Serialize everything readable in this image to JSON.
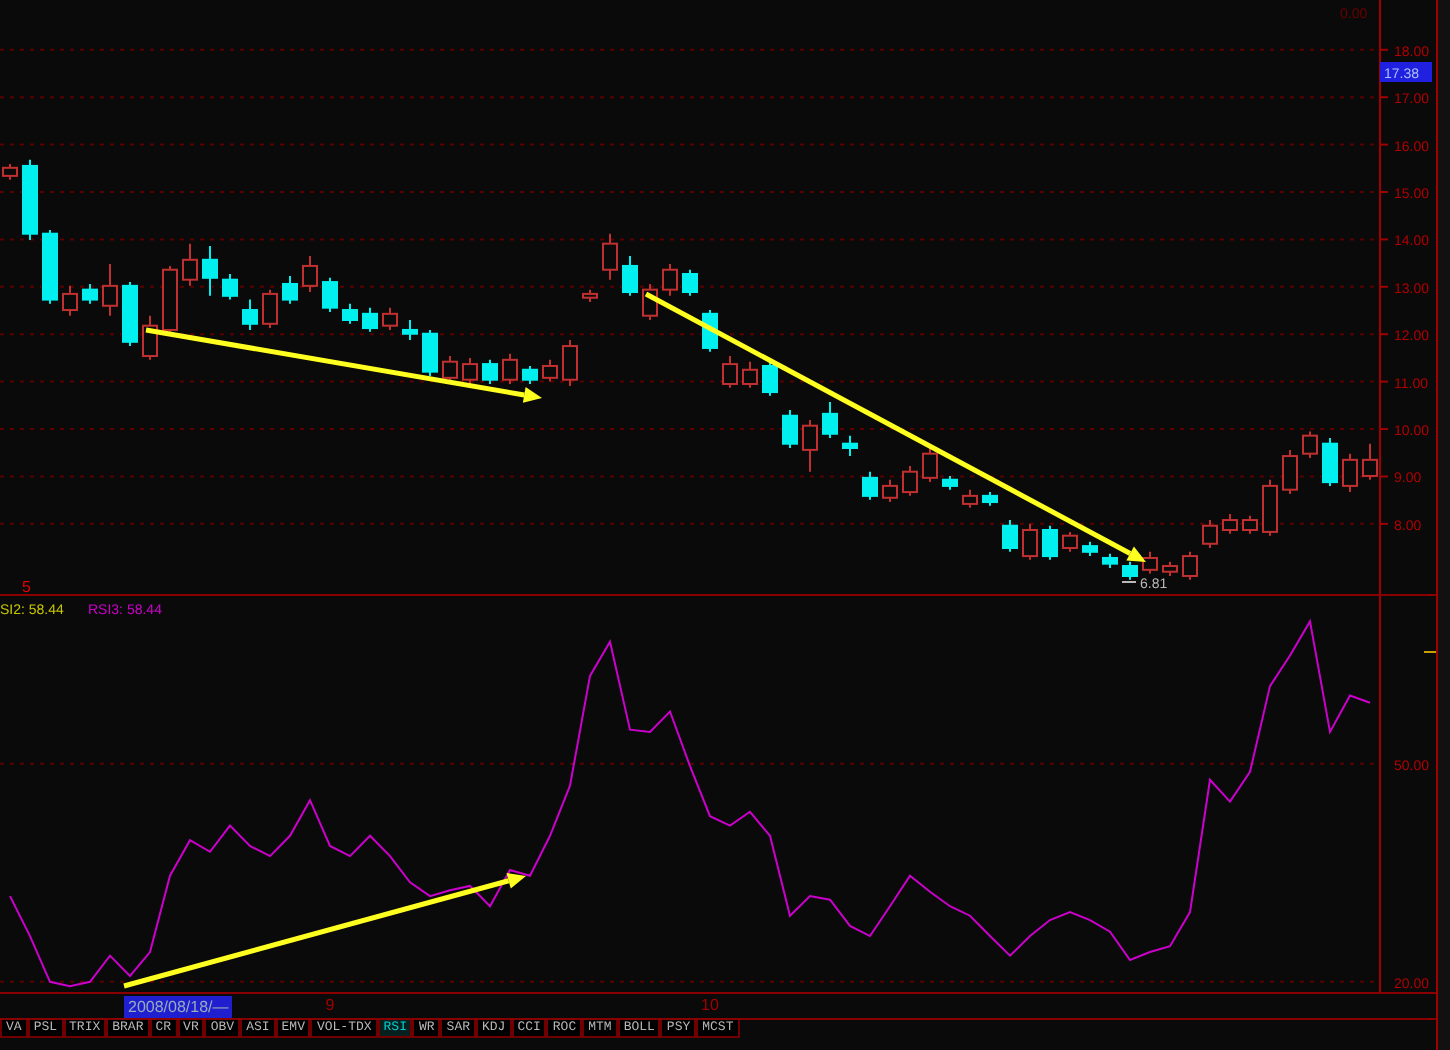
{
  "price_chart": {
    "top_label": "0.00",
    "last_price": "17.38",
    "low_marker": "6.81",
    "panel_marker": "5",
    "chart_data": {
      "type": "candlestick",
      "grid": true,
      "ylim": [
        6.52,
        19.05
      ],
      "categories": [
        null,
        null,
        null,
        null,
        null,
        null,
        null,
        null,
        null,
        null,
        null,
        null,
        null,
        null,
        null,
        null,
        null,
        null,
        null,
        null,
        null,
        null,
        null,
        null,
        null,
        null,
        null,
        null,
        null,
        null,
        null,
        null,
        null,
        null,
        null,
        null,
        null,
        null,
        null,
        null,
        null,
        null,
        null,
        null,
        null,
        null,
        null,
        null,
        null,
        null,
        null,
        null,
        null,
        null,
        null,
        null,
        null,
        null,
        null,
        null,
        null,
        null,
        null,
        null,
        null,
        null,
        null,
        null,
        null
      ],
      "yticks": [
        {
          "value": 18,
          "label": "18.00"
        },
        {
          "value": 17,
          "label": "17.00"
        },
        {
          "value": 16,
          "label": "16.00"
        },
        {
          "value": 15,
          "label": "15.00"
        },
        {
          "value": 14,
          "label": "14.00"
        },
        {
          "value": 13,
          "label": "13.00"
        },
        {
          "value": 12,
          "label": "12.00"
        },
        {
          "value": 11,
          "label": "11.00"
        },
        {
          "value": 10,
          "label": "10.00"
        },
        {
          "value": 9,
          "label": "9.00"
        },
        {
          "value": 8,
          "label": "8.00"
        }
      ],
      "ohlc": [
        [
          15.34,
          15.59,
          15.26,
          15.51
        ],
        [
          15.55,
          15.68,
          13.99,
          14.12
        ],
        [
          14.12,
          14.2,
          12.64,
          12.73
        ],
        [
          12.51,
          13.02,
          12.39,
          12.85
        ],
        [
          12.94,
          13.06,
          12.64,
          12.73
        ],
        [
          12.6,
          13.48,
          12.39,
          13.02
        ],
        [
          13.02,
          13.1,
          11.75,
          11.84
        ],
        [
          11.54,
          12.39,
          11.46,
          12.18
        ],
        [
          12.09,
          13.44,
          12.01,
          13.36
        ],
        [
          13.15,
          13.91,
          13.02,
          13.57
        ],
        [
          13.57,
          13.86,
          12.81,
          13.19
        ],
        [
          13.15,
          13.27,
          12.73,
          12.81
        ],
        [
          12.51,
          12.73,
          12.09,
          12.22
        ],
        [
          12.22,
          12.94,
          12.13,
          12.85
        ],
        [
          13.06,
          13.23,
          12.64,
          12.73
        ],
        [
          13.02,
          13.65,
          12.89,
          13.44
        ],
        [
          13.1,
          13.19,
          12.47,
          12.56
        ],
        [
          12.51,
          12.64,
          12.22,
          12.3
        ],
        [
          12.43,
          12.56,
          12.05,
          12.13
        ],
        [
          12.18,
          12.56,
          12.09,
          12.43
        ],
        [
          12.09,
          12.3,
          11.88,
          12.01
        ],
        [
          12.01,
          12.09,
          11.12,
          11.21
        ],
        [
          11.08,
          11.54,
          11.0,
          11.42
        ],
        [
          11.04,
          11.5,
          10.95,
          11.37
        ],
        [
          11.37,
          11.46,
          10.95,
          11.04
        ],
        [
          11.04,
          11.59,
          10.95,
          11.46
        ],
        [
          11.25,
          11.33,
          10.95,
          11.04
        ],
        [
          11.08,
          11.46,
          11.0,
          11.33
        ],
        [
          11.04,
          11.88,
          10.91,
          11.75
        ],
        [
          12.77,
          12.94,
          12.68,
          12.85
        ],
        [
          13.36,
          14.12,
          13.15,
          13.91
        ],
        [
          13.44,
          13.65,
          12.81,
          12.89
        ],
        [
          12.39,
          13.06,
          12.3,
          12.94
        ],
        [
          12.94,
          13.48,
          12.81,
          13.36
        ],
        [
          13.27,
          13.36,
          12.81,
          12.89
        ],
        [
          12.43,
          12.51,
          11.63,
          11.71
        ],
        [
          10.95,
          11.54,
          10.87,
          11.37
        ],
        [
          10.95,
          11.42,
          10.87,
          11.25
        ],
        [
          11.33,
          11.46,
          10.7,
          10.78
        ],
        [
          10.28,
          10.4,
          9.6,
          9.69
        ],
        [
          9.56,
          10.19,
          9.1,
          10.07
        ],
        [
          10.32,
          10.57,
          9.81,
          9.9
        ],
        [
          9.69,
          9.86,
          9.43,
          9.6
        ],
        [
          8.97,
          9.1,
          8.51,
          8.59
        ],
        [
          8.55,
          8.93,
          8.46,
          8.8
        ],
        [
          8.67,
          9.22,
          8.59,
          9.1
        ],
        [
          8.97,
          9.6,
          8.88,
          9.48
        ],
        [
          8.93,
          9.01,
          8.72,
          8.8
        ],
        [
          8.42,
          8.72,
          8.34,
          8.59
        ],
        [
          8.59,
          8.67,
          8.38,
          8.46
        ],
        [
          7.96,
          8.08,
          7.41,
          7.49
        ],
        [
          7.32,
          8.0,
          7.24,
          7.87
        ],
        [
          7.87,
          7.96,
          7.24,
          7.32
        ],
        [
          7.49,
          7.83,
          7.41,
          7.75
        ],
        [
          7.53,
          7.62,
          7.32,
          7.41
        ],
        [
          7.28,
          7.37,
          7.07,
          7.16
        ],
        [
          7.11,
          7.2,
          6.82,
          6.9
        ],
        [
          7.03,
          7.41,
          6.95,
          7.28
        ],
        [
          6.99,
          7.2,
          6.9,
          7.11
        ],
        [
          6.9,
          7.41,
          6.82,
          7.32
        ],
        [
          7.58,
          8.08,
          7.49,
          7.96
        ],
        [
          7.87,
          8.21,
          7.79,
          8.08
        ],
        [
          7.87,
          8.17,
          7.79,
          8.08
        ],
        [
          7.83,
          8.93,
          7.75,
          8.8
        ],
        [
          8.72,
          9.56,
          8.63,
          9.43
        ],
        [
          9.48,
          9.95,
          9.39,
          9.86
        ],
        [
          9.69,
          9.81,
          8.8,
          8.88
        ],
        [
          8.8,
          9.48,
          8.67,
          9.35
        ],
        [
          9.01,
          9.69,
          8.93,
          9.35
        ]
      ]
    }
  },
  "indicator": {
    "legend": [
      {
        "text": "SI2: 58.44",
        "color": "#c8c800"
      },
      {
        "text": "RSI3: 58.44",
        "color": "#cc00cc"
      }
    ],
    "chart_data": {
      "type": "line",
      "ylim": [
        18.6,
        73.1
      ],
      "yticks": [
        {
          "value": 50,
          "label": "50.00"
        },
        {
          "value": 20,
          "label": "20.00"
        }
      ],
      "categories": [
        null,
        null,
        null,
        null,
        null,
        null,
        null,
        null,
        null,
        null,
        null,
        null,
        null,
        null,
        null,
        null,
        "9",
        null,
        null,
        null,
        null,
        null,
        null,
        null,
        null,
        null,
        null,
        null,
        null,
        null,
        null,
        null,
        null,
        null,
        null,
        "10",
        null,
        null,
        null,
        null,
        null,
        null,
        null,
        null,
        null,
        null,
        null,
        null,
        null,
        null,
        null,
        null,
        null,
        null,
        null,
        null,
        null,
        null,
        null,
        null,
        null,
        null,
        null,
        null,
        null,
        null,
        null,
        null,
        null
      ],
      "series": [
        {
          "color": "#cc00cc",
          "values": [
            31.8,
            26.3,
            20.0,
            19.4,
            20.0,
            23.6,
            20.8,
            24.1,
            34.6,
            39.5,
            37.9,
            41.5,
            38.7,
            37.3,
            40.1,
            45.0,
            38.7,
            37.3,
            40.1,
            37.3,
            33.7,
            31.8,
            32.6,
            33.2,
            30.4,
            35.4,
            34.6,
            40.1,
            47.0,
            62.1,
            66.8,
            54.7,
            54.4,
            57.2,
            49.7,
            42.8,
            41.5,
            43.4,
            40.1,
            29.1,
            31.8,
            31.3,
            27.7,
            26.3,
            30.4,
            34.6,
            32.4,
            30.4,
            29.1,
            26.3,
            23.6,
            26.3,
            28.5,
            29.6,
            28.5,
            26.9,
            23.0,
            24.1,
            24.9,
            29.6,
            47.8,
            44.8,
            48.9,
            60.7,
            64.9,
            69.6,
            54.4,
            59.4,
            58.4
          ]
        }
      ]
    }
  },
  "date_bar": {
    "cursor_date": "2008/08/18/—"
  },
  "tabs": [
    {
      "label": "VA",
      "selected": false
    },
    {
      "label": "PSL",
      "selected": false
    },
    {
      "label": "TRIX",
      "selected": false
    },
    {
      "label": "BRAR",
      "selected": false
    },
    {
      "label": "CR",
      "selected": false
    },
    {
      "label": "VR",
      "selected": false
    },
    {
      "label": "OBV",
      "selected": false
    },
    {
      "label": "ASI",
      "selected": false
    },
    {
      "label": "EMV",
      "selected": false
    },
    {
      "label": "VOL-TDX",
      "selected": false
    },
    {
      "label": "RSI",
      "selected": true
    },
    {
      "label": "WR",
      "selected": false
    },
    {
      "label": "SAR",
      "selected": false
    },
    {
      "label": "KDJ",
      "selected": false
    },
    {
      "label": "CCI",
      "selected": false
    },
    {
      "label": "ROC",
      "selected": false
    },
    {
      "label": "MTM",
      "selected": false
    },
    {
      "label": "BOLL",
      "selected": false
    },
    {
      "label": "PSY",
      "selected": false
    },
    {
      "label": "MCST",
      "selected": false
    }
  ]
}
